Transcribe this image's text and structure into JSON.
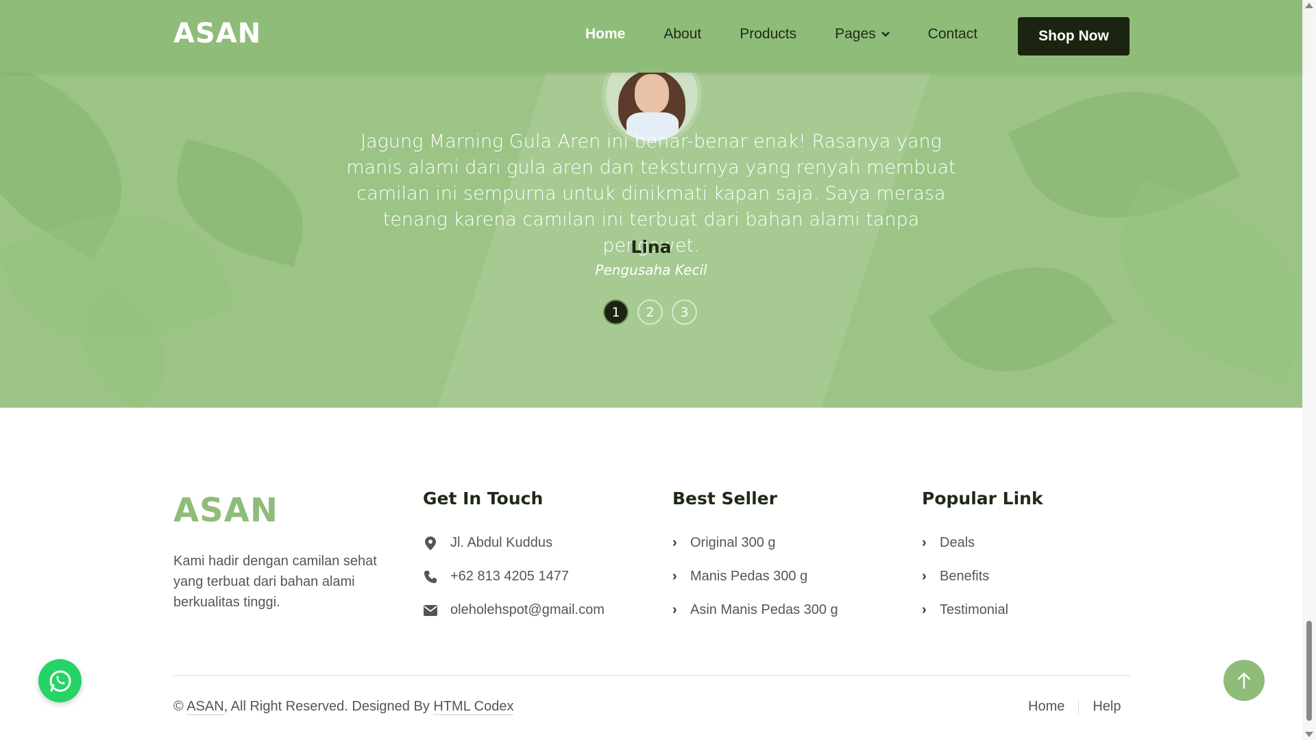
{
  "navbar": {
    "brand": "ASAN",
    "items": [
      {
        "label": "Home",
        "active": true
      },
      {
        "label": "About"
      },
      {
        "label": "Products"
      },
      {
        "label": "Pages",
        "dropdown": true
      },
      {
        "label": "Contact"
      }
    ],
    "cta": "Shop Now"
  },
  "testimonial": {
    "quote": "Jagung Marning Gula Aren ini benar-benar enak! Rasanya yang manis alami dari gula aren dan teksturnya yang renyah membuat camilan ini sempurna untuk dinikmati kapan saja. Saya merasa tenang karena camilan ini terbuat dari bahan alami tanpa pengawet.",
    "author": "Lina",
    "role": "Pengusaha Kecil",
    "pages": [
      "1",
      "2",
      "3"
    ],
    "active_page": 1
  },
  "footer": {
    "brand": "ASAN",
    "description": "Kami hadir dengan camilan sehat yang terbuat dari bahan alami berkualitas tinggi.",
    "get_in_touch": {
      "title": "Get In Touch",
      "address": "Jl. Abdul Kuddus",
      "phone": "+62 813 4205 1477",
      "email": "oleholehspot@gmail.com"
    },
    "best_seller": {
      "title": "Best Seller",
      "items": [
        "Original 300 g",
        "Manis Pedas 300 g",
        "Asin Manis Pedas 300 g"
      ]
    },
    "popular_link": {
      "title": "Popular Link",
      "items": [
        "Deals",
        "Benefits",
        "Testimonial"
      ]
    },
    "copyright_prefix": "©",
    "copyright_brand": "ASAN",
    "copyright_mid": ", All Right Reserved. Designed By",
    "copyright_designer": "HTML Codex",
    "links": [
      "Home",
      "Help"
    ]
  },
  "colors": {
    "nav_bg": "#8fbc79",
    "section_bg": "#9bc486",
    "dark": "#1b2410",
    "accent": "#8fbc79",
    "whatsapp": "#25d366"
  },
  "icons": [
    "location-pin-icon",
    "phone-icon",
    "envelope-icon",
    "chevron-right-icon",
    "whatsapp-icon",
    "arrow-up-icon",
    "chevron-down-icon"
  ]
}
